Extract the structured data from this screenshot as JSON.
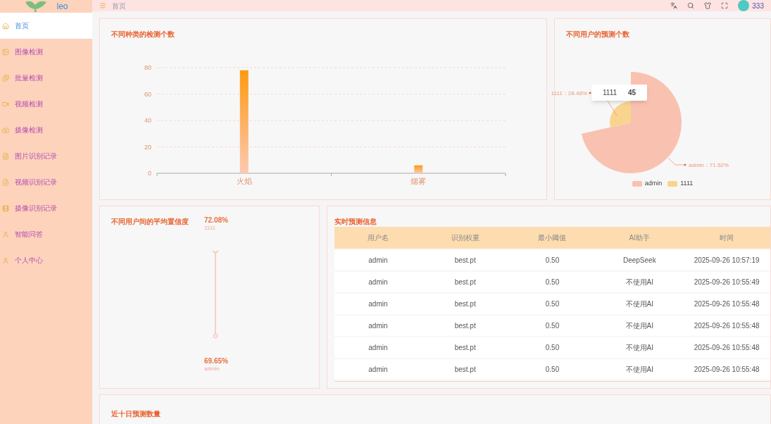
{
  "sidebar": {
    "logo_text": "leo",
    "items": [
      {
        "label": "首页",
        "selected": true
      },
      {
        "label": "图像检测",
        "selected": false
      },
      {
        "label": "批量检测",
        "selected": false
      },
      {
        "label": "视频检测",
        "selected": false
      },
      {
        "label": "摄像检测",
        "selected": false
      },
      {
        "label": "图片识别记录",
        "selected": false
      },
      {
        "label": "视频识别记录",
        "selected": false
      },
      {
        "label": "摄像识别记录",
        "selected": false
      },
      {
        "label": "智能问答",
        "selected": false
      },
      {
        "label": "个人中心",
        "selected": false
      }
    ]
  },
  "header": {
    "breadcrumb": "首页",
    "username": "333"
  },
  "bar_card": {
    "title": "不同种类的检测个数",
    "chart_data": {
      "type": "bar",
      "categories": [
        "火焰",
        "烟雾"
      ],
      "values": [
        78,
        6
      ],
      "ylim": [
        0,
        80
      ],
      "yticks": [
        0,
        20,
        40,
        60,
        80
      ],
      "grid": true
    }
  },
  "pie_card": {
    "title": "不同用户的预测个数",
    "slice_labels": [
      "admin：71.52%",
      "1111：28.48%"
    ],
    "tooltip": {
      "name": "1111",
      "value": "45"
    },
    "legend": [
      {
        "label": "admin",
        "color": "#f9c2b0"
      },
      {
        "label": "1111",
        "color": "#f9d48e"
      }
    ]
  },
  "confidence_card": {
    "title": "不同用户间的平均置信度",
    "points": [
      {
        "value": "72.08%",
        "name": "1111"
      },
      {
        "value": "69.65%",
        "name": "admin"
      }
    ]
  },
  "table_card": {
    "title": "实时预测信息",
    "columns": [
      "用户名",
      "识别权重",
      "最小阈值",
      "AI助手",
      "时间"
    ],
    "rows": [
      [
        "admin",
        "best.pt",
        "0.50",
        "DeepSeek",
        "2025-09-26 10:57:19"
      ],
      [
        "admin",
        "best.pt",
        "0.50",
        "不使用AI",
        "2025-09-26 10:55:49"
      ],
      [
        "admin",
        "best.pt",
        "0.50",
        "不使用AI",
        "2025-09-26 10:55:48"
      ],
      [
        "admin",
        "best.pt",
        "0.50",
        "不使用AI",
        "2025-09-26 10:55:48"
      ],
      [
        "admin",
        "best.pt",
        "0.50",
        "不使用AI",
        "2025-09-26 10:55:48"
      ],
      [
        "admin",
        "best.pt",
        "0.50",
        "不使用AI",
        "2025-09-26 10:55:48"
      ]
    ]
  },
  "bottom_card": {
    "title": "近十日预测数量"
  }
}
